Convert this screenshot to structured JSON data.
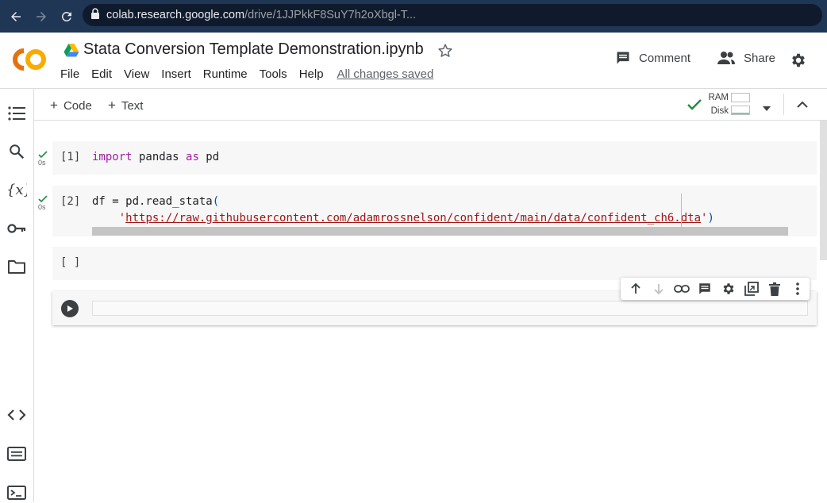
{
  "browser": {
    "url_host": "colab.research.google.com",
    "url_path": "/drive/1JJPkkF8SuY7h2oXbgl-T..."
  },
  "header": {
    "title": "Stata Conversion Template Demonstration.ipynb",
    "menu": [
      "File",
      "Edit",
      "View",
      "Insert",
      "Runtime",
      "Tools",
      "Help"
    ],
    "save_status": "All changes saved",
    "comment_label": "Comment",
    "share_label": "Share"
  },
  "toolbar": {
    "add_code_label": "Code",
    "add_text_label": "Text",
    "ram_label": "RAM",
    "disk_label": "Disk"
  },
  "cells": [
    {
      "exec": "[1]",
      "time": "0s"
    },
    {
      "exec": "[2]",
      "time": "0s"
    },
    {
      "exec": "[ ]"
    }
  ],
  "code": {
    "cell1_import": "import",
    "cell1_module": " pandas ",
    "cell1_as": "as",
    "cell1_alias": " pd",
    "cell2_line1": "df = pd.read_stata",
    "cell2_open_paren": "(",
    "cell2_indent": "    ",
    "cell2_quote_open": "'",
    "cell2_url": "https://raw.githubusercontent.com/adamrossnelson/confident/main/data/confident_ch6.dta",
    "cell2_quote_close": "'",
    "cell2_close_paren": ")"
  },
  "colors": {
    "browser_bar": "#1f3655",
    "keyword": "#a020a0",
    "string": "#a31515",
    "success": "#1e8e3e",
    "logo_orange": "#f9ab00",
    "logo_dark_orange": "#e8710a"
  }
}
